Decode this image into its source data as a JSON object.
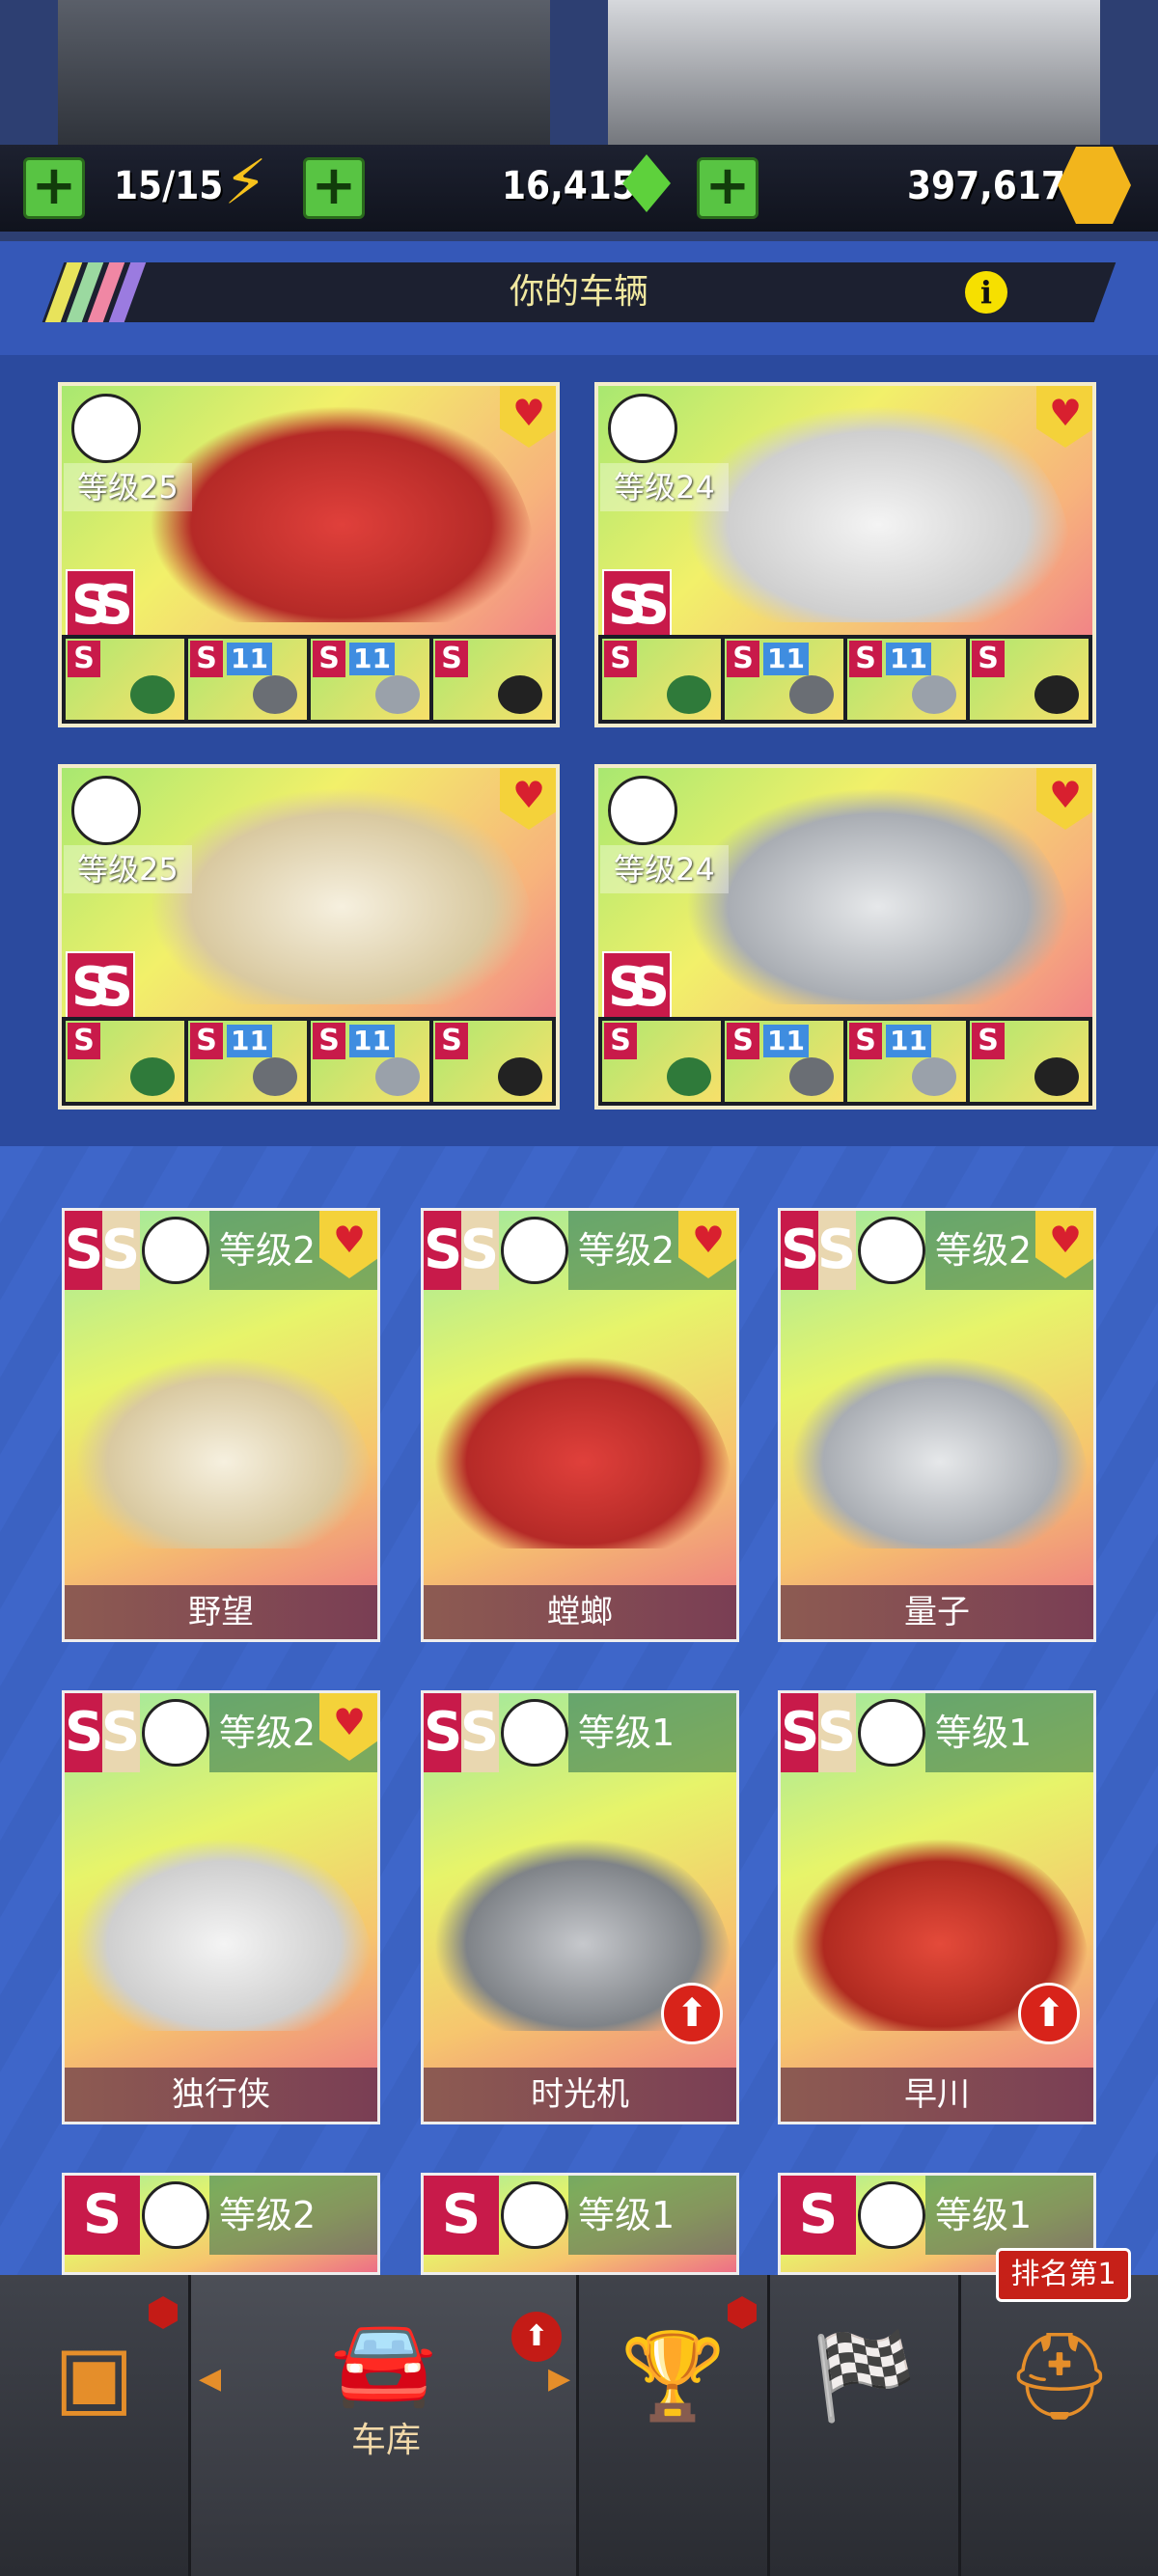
{
  "resources": {
    "energy": "15/15",
    "gems": "16,415",
    "coins": "397,617"
  },
  "header": {
    "title": "你的车辆",
    "info_icon": "i"
  },
  "featured_cars": [
    {
      "level": "等级25",
      "class_icon": "road-icon",
      "tier": "SS",
      "color": "#e0403b",
      "parts": [
        {
          "tier": "S",
          "level": ""
        },
        {
          "tier": "S",
          "level": "11"
        },
        {
          "tier": "S",
          "level": "11"
        },
        {
          "tier": "S",
          "level": ""
        }
      ]
    },
    {
      "level": "等级24",
      "class_icon": "horse-icon",
      "tier": "SS",
      "color": "#eaeaea",
      "parts": [
        {
          "tier": "S",
          "level": ""
        },
        {
          "tier": "S",
          "level": "11"
        },
        {
          "tier": "S",
          "level": "11"
        },
        {
          "tier": "S",
          "level": ""
        }
      ]
    },
    {
      "level": "等级25",
      "class_icon": "wheel-icon",
      "tier": "SS",
      "color": "#f3ecd8",
      "parts": [
        {
          "tier": "S",
          "level": ""
        },
        {
          "tier": "S",
          "level": "11"
        },
        {
          "tier": "S",
          "level": "11"
        },
        {
          "tier": "S",
          "level": ""
        }
      ]
    },
    {
      "level": "等级24",
      "class_icon": "crown-icon",
      "tier": "SS",
      "color": "#cfd2d6",
      "parts": [
        {
          "tier": "S",
          "level": ""
        },
        {
          "tier": "S",
          "level": "11"
        },
        {
          "tier": "S",
          "level": "11"
        },
        {
          "tier": "S",
          "level": ""
        }
      ]
    }
  ],
  "cars": [
    {
      "name": "野望",
      "level": "等级2",
      "tier": "SS",
      "class_icon": "wheel-icon",
      "favorite": true,
      "upgrade": false,
      "color": "#f3ecd8"
    },
    {
      "name": "螳螂",
      "level": "等级2",
      "tier": "SS",
      "class_icon": "road-icon",
      "favorite": true,
      "upgrade": false,
      "color": "#e0403b"
    },
    {
      "name": "量子",
      "level": "等级2",
      "tier": "SS",
      "class_icon": "crown-icon",
      "favorite": true,
      "upgrade": false,
      "color": "#cfd2d6"
    },
    {
      "name": "独行侠",
      "level": "等级2",
      "tier": "SS",
      "class_icon": "horse-icon",
      "favorite": true,
      "upgrade": false,
      "color": "#eaeaea"
    },
    {
      "name": "时光机",
      "level": "等级1",
      "tier": "SS",
      "class_icon": "crown-icon",
      "favorite": false,
      "upgrade": true,
      "color": "#a7a9ad"
    },
    {
      "name": "早川",
      "level": "等级1",
      "tier": "SS",
      "class_icon": "road-icon",
      "favorite": false,
      "upgrade": true,
      "color": "#d83a2c"
    },
    {
      "name": "",
      "level": "等级2",
      "tier": "S",
      "class_icon": "wheel-icon",
      "favorite": false,
      "upgrade": false,
      "color": "#888"
    },
    {
      "name": "",
      "level": "等级1",
      "tier": "S",
      "class_icon": "horse-icon",
      "favorite": false,
      "upgrade": false,
      "color": "#888"
    },
    {
      "name": "",
      "level": "等级1",
      "tier": "S",
      "class_icon": "crown-icon",
      "favorite": false,
      "upgrade": false,
      "color": "#888"
    }
  ],
  "nav": {
    "garage_label": "车库",
    "rank_badge": "排名第1"
  },
  "colors": {
    "accent_orange": "#e58e2a",
    "tier_red": "#c81a4a",
    "plus_green": "#58c443"
  }
}
